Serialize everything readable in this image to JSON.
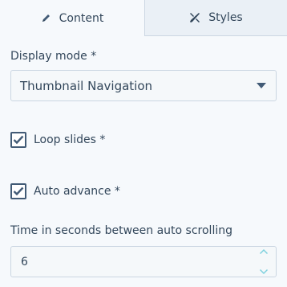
{
  "tabs": [
    {
      "label": "Content",
      "icon": "pencil-icon"
    },
    {
      "label": "Styles",
      "icon": "paint-tools-icon"
    }
  ],
  "display_mode": {
    "label": "Display mode *",
    "value": "Thumbnail Navigation"
  },
  "loop_slides": {
    "label": "Loop slides *",
    "checked": true
  },
  "auto_advance": {
    "label": "Auto advance *",
    "checked": true
  },
  "auto_scroll_time": {
    "label": "Time in seconds between auto scrolling",
    "value": "6"
  },
  "colors": {
    "text": "#33475b",
    "border": "#cbd6e2",
    "checkbox": "#425b76",
    "inactive_tab_bg": "#eaf0f6",
    "stepper_arrow": "#7fd1de"
  }
}
